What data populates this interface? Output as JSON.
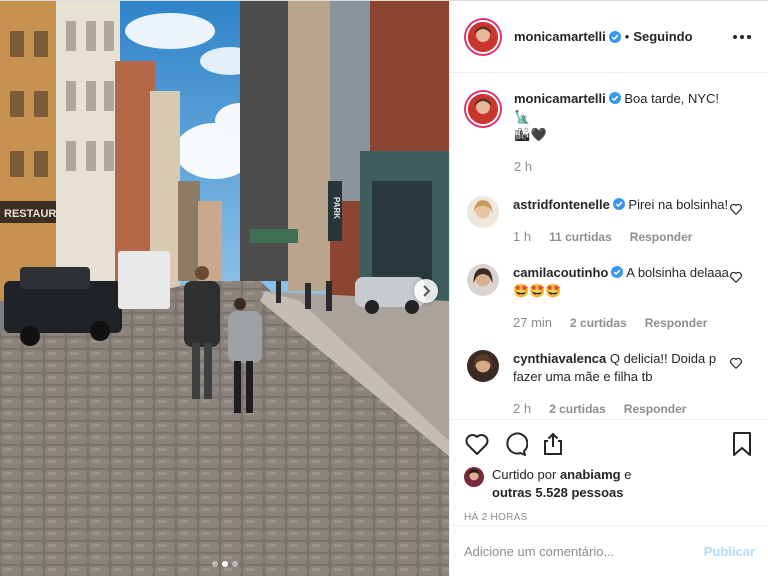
{
  "post": {
    "author": "monicamartelli",
    "follow_status": "Seguindo",
    "separator": "•"
  },
  "caption": {
    "author": "monicamartelli",
    "text": "Boa tarde, NYC! 🗽",
    "text2": "🏙🖤",
    "time": "2 h"
  },
  "comments": [
    {
      "author": "astridfontenelle",
      "text": "Pirei na bolsinha!",
      "time": "1 h",
      "likes": "11 curtidas",
      "reply": "Responder"
    },
    {
      "author": "camilacoutinho",
      "text": "A bolsinha delaaa🤩🤩🤩",
      "time": "27 min",
      "likes": "2 curtidas",
      "reply": "Responder"
    },
    {
      "author": "cynthiavalenca",
      "text": "Q delicia!! Doida p fazer uma mãe e filha tb",
      "time": "2 h",
      "likes": "2 curtidas",
      "reply": "Responder"
    }
  ],
  "likes": {
    "prefix": "Curtido por",
    "user": "anabiamg",
    "connector": "e",
    "others": "outras 5.528 pessoas"
  },
  "time_ago": "HÁ 2 HORAS",
  "add_comment": {
    "placeholder": "Adicione um comentário...",
    "publish": "Publicar"
  },
  "photo": {
    "signs": {
      "restaurant": "RESTAURANT",
      "parking": "PARK"
    },
    "carousel_count": 3,
    "carousel_active": 1
  },
  "colors": {
    "verified": "#3897f0",
    "avatar_ring": "#e1306c",
    "muted": "#8e8e8e",
    "publish_disabled": "#b3dbff"
  },
  "icons": [
    "verified-icon",
    "more-options-icon",
    "heart-icon",
    "comment-icon",
    "share-icon",
    "bookmark-icon",
    "chevron-right-icon"
  ]
}
